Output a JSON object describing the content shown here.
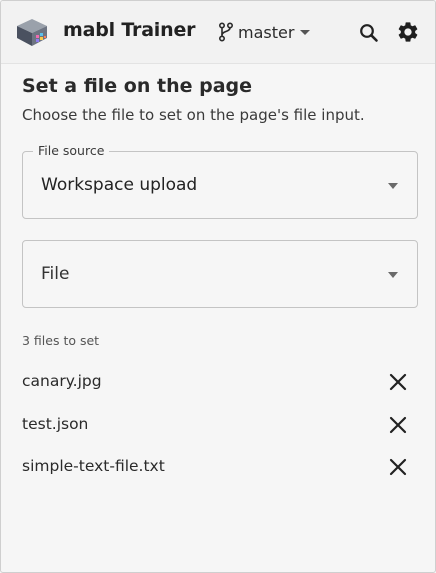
{
  "header": {
    "app_title": "mabl Trainer",
    "branch": "master"
  },
  "page": {
    "title": "Set a file on the page",
    "subtitle": "Choose the file to set on the page's file input."
  },
  "file_source": {
    "legend": "File source",
    "value": "Workspace upload"
  },
  "file_select": {
    "placeholder": "File"
  },
  "files": {
    "count_label": "3 files to set",
    "items": [
      {
        "name": "canary.jpg"
      },
      {
        "name": "test.json"
      },
      {
        "name": "simple-text-file.txt"
      }
    ]
  },
  "colors": {
    "background": "#f6f6f6",
    "text": "#2a2a2a",
    "border": "#c4c4c4"
  }
}
